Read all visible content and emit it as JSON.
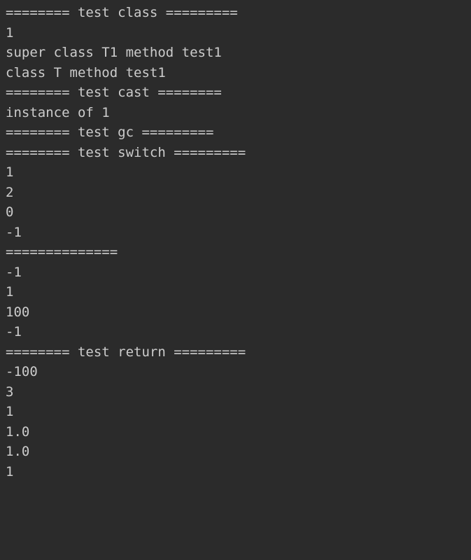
{
  "terminal": {
    "lines": [
      "======== test class =========",
      "1",
      "super class T1 method test1",
      "class T method test1",
      "======== test cast ========",
      "instance of 1",
      "======== test gc =========",
      "======== test switch =========",
      "1",
      "2",
      "0",
      "-1",
      "==============",
      "-1",
      "1",
      "100",
      "-1",
      "======== test return =========",
      "-100",
      "3",
      "1",
      "1.0",
      "1.0",
      "1"
    ]
  }
}
